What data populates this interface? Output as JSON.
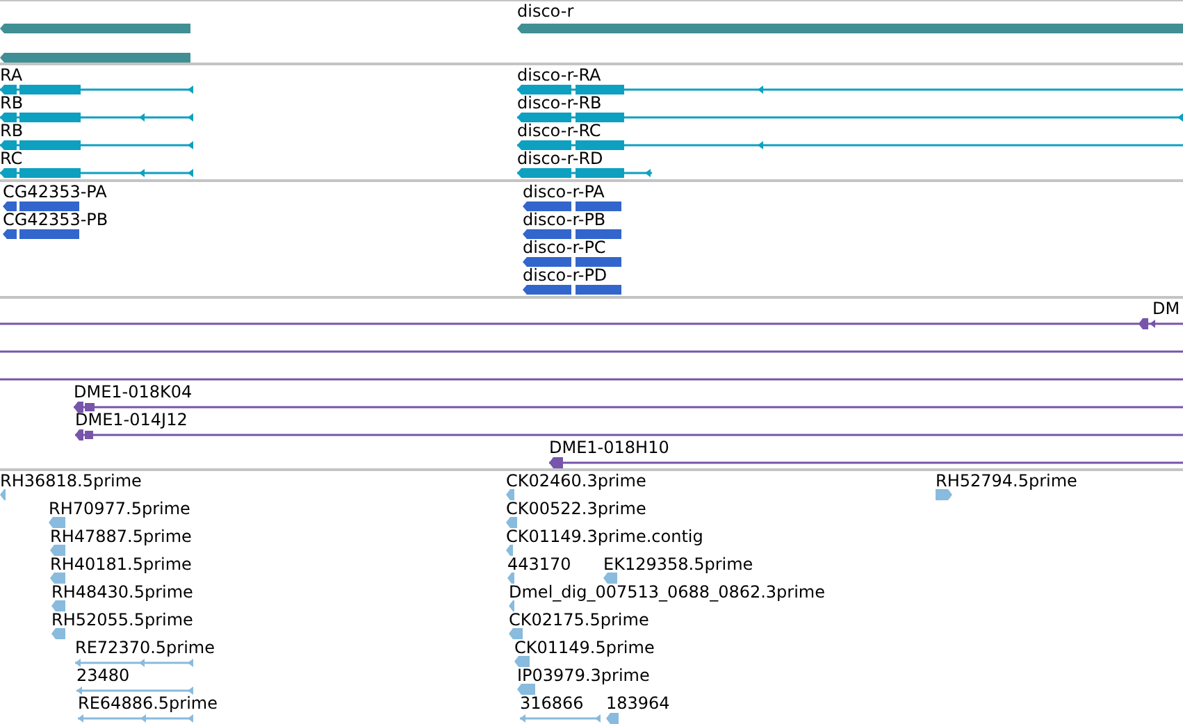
{
  "tracks": [
    {
      "kind": "gene",
      "features": [
        {
          "reverse": true
        },
        {
          "reverse": true
        },
        {
          "label": "disco-r",
          "reverse": true
        }
      ]
    },
    {
      "kind": "transcript",
      "features": [
        {
          "label": "RA",
          "reverse": true
        },
        {
          "label": "RB",
          "reverse": true
        },
        {
          "label": "RB",
          "reverse": true
        },
        {
          "label": "RC",
          "reverse": true
        },
        {
          "label": "disco-r-RA",
          "reverse": true
        },
        {
          "label": "disco-r-RB",
          "reverse": true
        },
        {
          "label": "disco-r-RC",
          "reverse": true
        },
        {
          "label": "disco-r-RD",
          "reverse": true
        }
      ]
    },
    {
      "kind": "protein",
      "features": [
        {
          "label": "CG42353-PA",
          "reverse": true
        },
        {
          "label": "CG42353-PB",
          "reverse": true
        },
        {
          "label": "disco-r-PA",
          "reverse": true
        },
        {
          "label": "disco-r-PB",
          "reverse": true
        },
        {
          "label": "disco-r-PC",
          "reverse": true
        },
        {
          "label": "disco-r-PD",
          "reverse": true
        }
      ]
    },
    {
      "kind": "clone",
      "features": [
        {
          "kind": "end",
          "label": "DM",
          "reverse": true
        },
        {
          "kind": "span"
        },
        {
          "kind": "span"
        },
        {
          "kind": "end",
          "label": "DME1-018K04",
          "reverse": true
        },
        {
          "kind": "end",
          "label": "DME1-014J12",
          "reverse": true
        },
        {
          "kind": "end",
          "label": "DME1-018H10",
          "reverse": true
        }
      ]
    },
    {
      "kind": "est",
      "features": [
        {
          "label": "RH36818.5prime",
          "reverse": true
        },
        {
          "label": "RH70977.5prime",
          "reverse": true
        },
        {
          "label": "RH47887.5prime",
          "reverse": true
        },
        {
          "label": "RH40181.5prime",
          "reverse": true
        },
        {
          "label": "RH48430.5prime",
          "reverse": true
        },
        {
          "label": "RH52055.5prime",
          "reverse": true
        },
        {
          "label": "RE72370.5prime",
          "reverse": true
        },
        {
          "label": "23480",
          "reverse": true
        },
        {
          "label": "RE64886.5prime",
          "reverse": true
        },
        {
          "label": "CK02460.3prime",
          "reverse": true
        },
        {
          "label": "CK00522.3prime",
          "reverse": true
        },
        {
          "label": "CK01149.3prime.contig",
          "reverse": true
        },
        {
          "label": "443170",
          "reverse": true
        },
        {
          "label": "EK129358.5prime",
          "reverse": true
        },
        {
          "label": "Dmel_dig_007513_0688_0862.3prime",
          "reverse": true
        },
        {
          "label": "CK02175.5prime",
          "reverse": true
        },
        {
          "label": "CK01149.5prime",
          "reverse": true
        },
        {
          "label": "IP03979.3prime",
          "reverse": true
        },
        {
          "label": "316866",
          "reverse": true
        },
        {
          "label": "183964",
          "reverse": true
        },
        {
          "label": "RH52794.5prime",
          "reverse": false
        }
      ]
    }
  ]
}
